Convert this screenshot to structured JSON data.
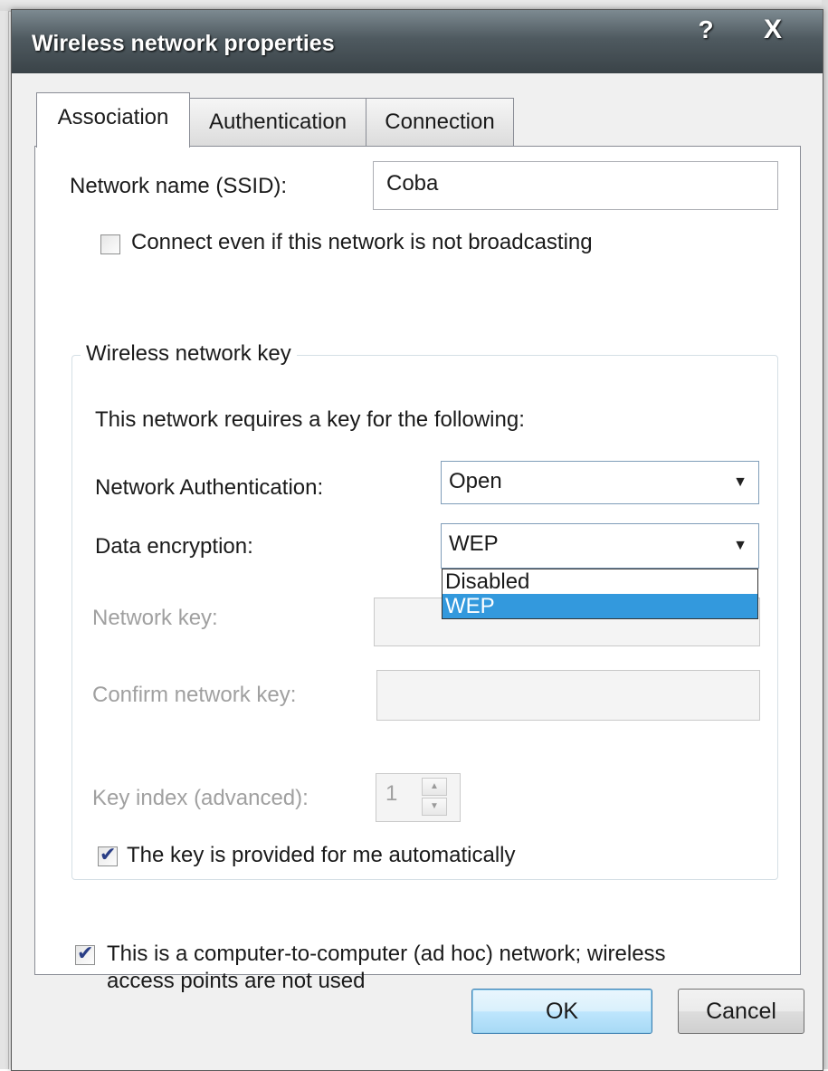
{
  "window": {
    "title": "Wireless network properties",
    "help_label": "?",
    "close_label": "X"
  },
  "tabs": [
    {
      "label": "Association",
      "active": true
    },
    {
      "label": "Authentication",
      "active": false
    },
    {
      "label": "Connection",
      "active": false
    }
  ],
  "association": {
    "ssid_label": "Network name (SSID):",
    "ssid_value": "Coba",
    "broadcast_checkbox": {
      "label": "Connect even if this network is not broadcasting",
      "checked": false
    },
    "key_group": {
      "title": "Wireless network key",
      "intro": "This network requires a key for the following:",
      "auth_label": "Network Authentication:",
      "auth_value": "Open",
      "encryption_label": "Data encryption:",
      "encryption_value": "WEP",
      "encryption_options": [
        {
          "label": "Disabled",
          "selected": false
        },
        {
          "label": "WEP",
          "selected": true
        }
      ],
      "network_key_label": "Network key:",
      "confirm_key_label": "Confirm network key:",
      "key_index_label": "Key index (advanced):",
      "key_index_value": "1",
      "auto_key_checkbox": {
        "label": "The key is provided for me automatically",
        "checked": true
      }
    },
    "adhoc_checkbox": {
      "label_line1": "This is a computer-to-computer (ad hoc) network; wireless",
      "label_line2": "access points are not used",
      "checked": true
    }
  },
  "buttons": {
    "ok": "OK",
    "cancel": "Cancel"
  },
  "icons": {
    "checkmark": "✔",
    "dropdown_arrow": "▼",
    "spin_up": "▲",
    "spin_down": "▼"
  },
  "colors": {
    "titlebar": "#4f5a60",
    "selection": "#3399dd"
  }
}
